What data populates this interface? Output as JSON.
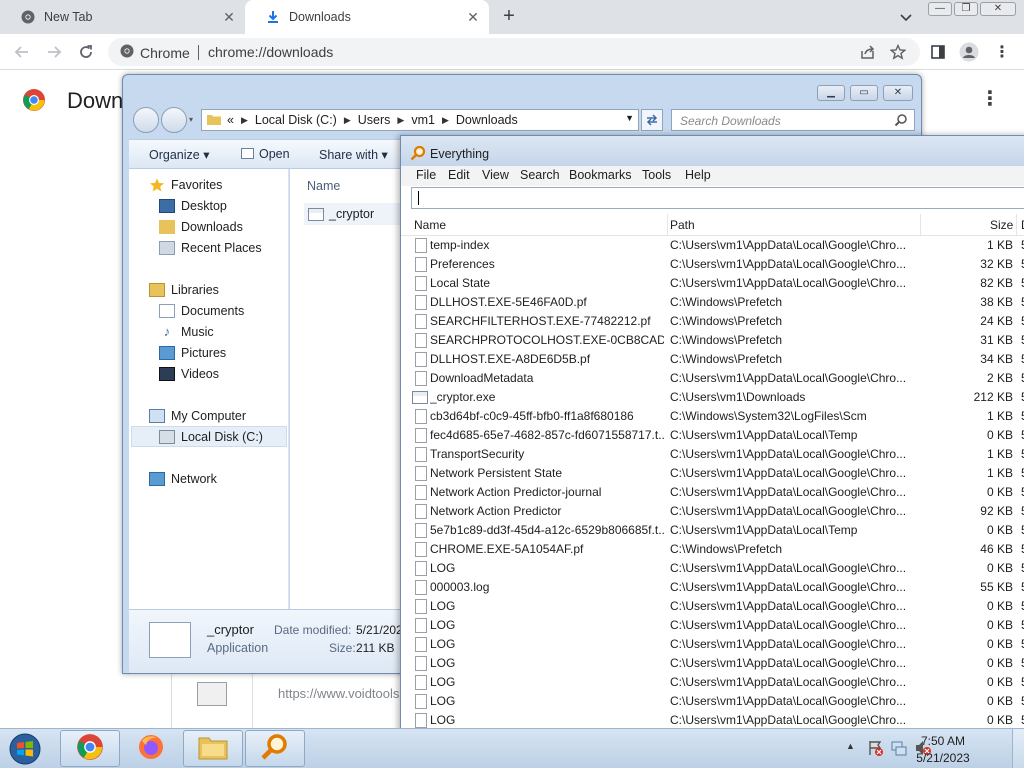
{
  "browser": {
    "tabs": [
      {
        "label": "New Tab"
      },
      {
        "label": "Downloads"
      }
    ],
    "omnibox": {
      "chip_label": "Chrome",
      "url": "chrome://downloads"
    },
    "page": {
      "title": "Downl",
      "card_url": "https://www.voidtools"
    }
  },
  "explorer": {
    "address": {
      "prefix": "«",
      "crumbs": [
        "Local Disk (C:)",
        "Users",
        "vm1",
        "Downloads"
      ]
    },
    "search_placeholder": "Search Downloads",
    "commands": {
      "organize": "Organize",
      "open": "Open",
      "share": "Share with"
    },
    "nav": {
      "favorites": "Favorites",
      "desktop": "Desktop",
      "downloads": "Downloads",
      "recent": "Recent Places",
      "libraries": "Libraries",
      "documents": "Documents",
      "music": "Music",
      "pictures": "Pictures",
      "videos": "Videos",
      "computer": "My Computer",
      "local_disk": "Local Disk (C:)",
      "network": "Network"
    },
    "column_name": "Name",
    "file_name": "_cryptor",
    "details": {
      "name": "_cryptor",
      "type": "Application",
      "modified_label": "Date modified:",
      "modified_value": "5/21/202",
      "size_label": "Size:",
      "size_value": "211 KB"
    }
  },
  "everything": {
    "title": "Everything",
    "menus": [
      "File",
      "Edit",
      "View",
      "Search",
      "Bookmarks",
      "Tools",
      "Help"
    ],
    "search_value": "",
    "columns": {
      "name": "Name",
      "path": "Path",
      "size": "Size",
      "extra": "D"
    },
    "rows": [
      {
        "name": "temp-index",
        "path": "C:\\Users\\vm1\\AppData\\Local\\Google\\Chro...",
        "size": "1 KB",
        "trunc": "5"
      },
      {
        "name": "Preferences",
        "path": "C:\\Users\\vm1\\AppData\\Local\\Google\\Chro...",
        "size": "32 KB",
        "trunc": "5"
      },
      {
        "name": "Local State",
        "path": "C:\\Users\\vm1\\AppData\\Local\\Google\\Chro...",
        "size": "82 KB",
        "trunc": "5"
      },
      {
        "name": "DLLHOST.EXE-5E46FA0D.pf",
        "path": "C:\\Windows\\Prefetch",
        "size": "38 KB",
        "trunc": "5"
      },
      {
        "name": "SEARCHFILTERHOST.EXE-77482212.pf",
        "path": "C:\\Windows\\Prefetch",
        "size": "24 KB",
        "trunc": "5"
      },
      {
        "name": "SEARCHPROTOCOLHOST.EXE-0CB8CADE...",
        "path": "C:\\Windows\\Prefetch",
        "size": "31 KB",
        "trunc": "5"
      },
      {
        "name": "DLLHOST.EXE-A8DE6D5B.pf",
        "path": "C:\\Windows\\Prefetch",
        "size": "34 KB",
        "trunc": "5"
      },
      {
        "name": "DownloadMetadata",
        "path": "C:\\Users\\vm1\\AppData\\Local\\Google\\Chro...",
        "size": "2 KB",
        "trunc": "5"
      },
      {
        "name": "_cryptor.exe",
        "path": "C:\\Users\\vm1\\Downloads",
        "size": "212 KB",
        "trunc": "5",
        "exe": true
      },
      {
        "name": "cb3d64bf-c0c9-45ff-bfb0-ff1a8f680186",
        "path": "C:\\Windows\\System32\\LogFiles\\Scm",
        "size": "1 KB",
        "trunc": "5"
      },
      {
        "name": "fec4d685-65e7-4682-857c-fd6071558717.t...",
        "path": "C:\\Users\\vm1\\AppData\\Local\\Temp",
        "size": "0 KB",
        "trunc": "5"
      },
      {
        "name": "TransportSecurity",
        "path": "C:\\Users\\vm1\\AppData\\Local\\Google\\Chro...",
        "size": "1 KB",
        "trunc": "5"
      },
      {
        "name": "Network Persistent State",
        "path": "C:\\Users\\vm1\\AppData\\Local\\Google\\Chro...",
        "size": "1 KB",
        "trunc": "5"
      },
      {
        "name": "Network Action Predictor-journal",
        "path": "C:\\Users\\vm1\\AppData\\Local\\Google\\Chro...",
        "size": "0 KB",
        "trunc": "5"
      },
      {
        "name": "Network Action Predictor",
        "path": "C:\\Users\\vm1\\AppData\\Local\\Google\\Chro...",
        "size": "92 KB",
        "trunc": "5"
      },
      {
        "name": "5e7b1c89-dd3f-45d4-a12c-6529b806685f.t...",
        "path": "C:\\Users\\vm1\\AppData\\Local\\Temp",
        "size": "0 KB",
        "trunc": "5"
      },
      {
        "name": "CHROME.EXE-5A1054AF.pf",
        "path": "C:\\Windows\\Prefetch",
        "size": "46 KB",
        "trunc": "5"
      },
      {
        "name": "LOG",
        "path": "C:\\Users\\vm1\\AppData\\Local\\Google\\Chro...",
        "size": "0 KB",
        "trunc": "5"
      },
      {
        "name": "000003.log",
        "path": "C:\\Users\\vm1\\AppData\\Local\\Google\\Chro...",
        "size": "55 KB",
        "trunc": "5"
      },
      {
        "name": "LOG",
        "path": "C:\\Users\\vm1\\AppData\\Local\\Google\\Chro...",
        "size": "0 KB",
        "trunc": "5"
      },
      {
        "name": "LOG",
        "path": "C:\\Users\\vm1\\AppData\\Local\\Google\\Chro...",
        "size": "0 KB",
        "trunc": "5"
      },
      {
        "name": "LOG",
        "path": "C:\\Users\\vm1\\AppData\\Local\\Google\\Chro...",
        "size": "0 KB",
        "trunc": "5"
      },
      {
        "name": "LOG",
        "path": "C:\\Users\\vm1\\AppData\\Local\\Google\\Chro...",
        "size": "0 KB",
        "trunc": "5"
      },
      {
        "name": "LOG",
        "path": "C:\\Users\\vm1\\AppData\\Local\\Google\\Chro...",
        "size": "0 KB",
        "trunc": "5"
      },
      {
        "name": "LOG",
        "path": "C:\\Users\\vm1\\AppData\\Local\\Google\\Chro...",
        "size": "0 KB",
        "trunc": "5"
      },
      {
        "name": "LOG",
        "path": "C:\\Users\\vm1\\AppData\\Local\\Google\\Chro...",
        "size": "0 KB",
        "trunc": "5"
      }
    ]
  },
  "taskbar": {
    "time": "7:50 AM",
    "date": "5/21/2023",
    "apps": [
      "chrome-icon",
      "firefox-icon",
      "explorer-icon",
      "everything-icon"
    ]
  },
  "colors": {
    "chrome_tabstrip": "#dee1e6",
    "win7_glass": "#c7d9ee",
    "taskbar": "#bcd0e6",
    "chrome_blue": "#1a73e8"
  }
}
